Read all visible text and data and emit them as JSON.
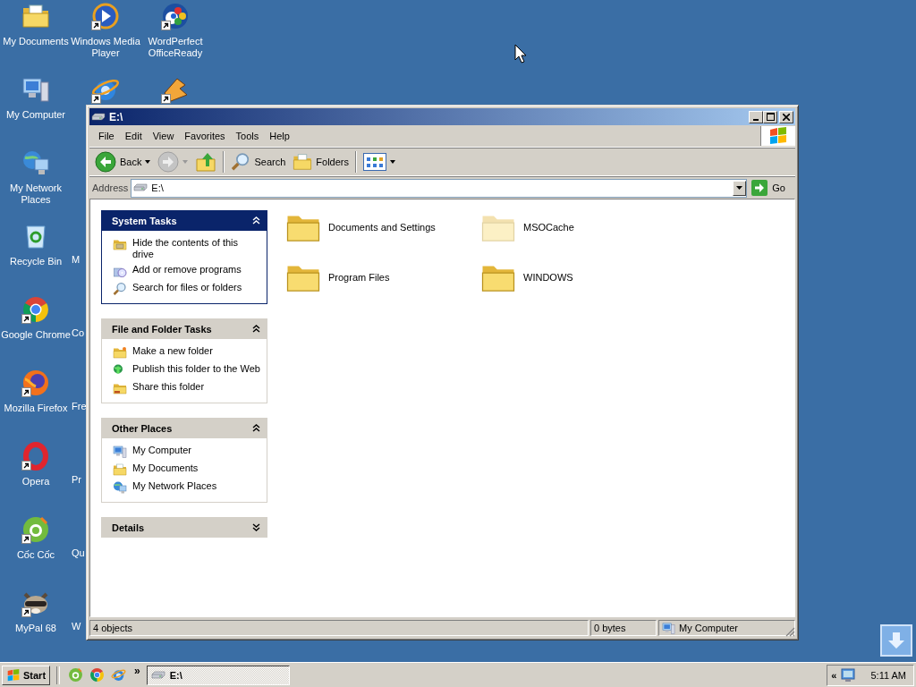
{
  "desktop": {
    "icons": [
      {
        "kind": "documents",
        "label": "My Documents",
        "shortcut": false
      },
      {
        "kind": "media-player",
        "label": "Windows Media Player",
        "shortcut": true
      },
      {
        "kind": "wordperfect",
        "label": "WordPerfect OfficeReady",
        "shortcut": true
      },
      {
        "kind": "computer",
        "label": "My Computer",
        "shortcut": false
      },
      {
        "kind": "ie",
        "shortcut": true
      },
      {
        "kind": "winamp",
        "shortcut": true
      },
      {
        "kind": "network",
        "label": "My Network Places",
        "shortcut": false
      },
      {
        "kind": "recycle",
        "label": "Recycle Bin",
        "shortcut": false
      },
      {
        "kind": "chrome",
        "label": "Google Chrome",
        "shortcut": true
      },
      {
        "kind": "firefox",
        "label": "Mozilla Firefox",
        "shortcut": true
      },
      {
        "kind": "opera",
        "label": "Opera",
        "shortcut": true
      },
      {
        "kind": "coccoc",
        "label": "Cốc Cốc",
        "shortcut": true
      },
      {
        "kind": "mypal",
        "label": "MyPal 68",
        "shortcut": true
      },
      {
        "kind": "covered",
        "label": "M"
      },
      {
        "kind": "covered",
        "label": "Co"
      },
      {
        "kind": "covered",
        "label": "Fre"
      },
      {
        "kind": "covered",
        "label": "Pr"
      },
      {
        "kind": "covered",
        "label": "Qu"
      },
      {
        "kind": "covered",
        "label": "W"
      }
    ]
  },
  "window": {
    "title": "E:\\",
    "menu": [
      "File",
      "Edit",
      "View",
      "Favorites",
      "Tools",
      "Help"
    ],
    "toolbar": [
      {
        "kind": "back",
        "label": "Back",
        "disabled": false
      },
      {
        "kind": "forward",
        "disabled": true
      },
      {
        "kind": "up"
      },
      {
        "kind": "search",
        "label": "Search"
      },
      {
        "kind": "folders",
        "label": "Folders"
      },
      {
        "kind": "views"
      }
    ],
    "address": {
      "label": "Address",
      "value": "E:\\",
      "go": "Go"
    },
    "task_panes": [
      {
        "title": "System Tasks",
        "kind": "special",
        "expanded": true,
        "items": [
          {
            "label": "Hide the contents of this drive"
          },
          {
            "label": "Add or remove programs"
          },
          {
            "label": "Search for files or folders"
          }
        ]
      },
      {
        "title": "File and Folder Tasks",
        "kind": "normal",
        "expanded": true,
        "items": [
          {
            "label": "Make a new folder"
          },
          {
            "label": "Publish this folder to the Web"
          },
          {
            "label": "Share this folder"
          }
        ]
      },
      {
        "title": "Other Places",
        "kind": "normal",
        "expanded": true,
        "items": [
          {
            "label": "My Computer"
          },
          {
            "label": "My Documents"
          },
          {
            "label": "My Network Places"
          }
        ]
      },
      {
        "title": "Details",
        "kind": "normal",
        "expanded": false
      }
    ],
    "files": [
      {
        "name": "Documents and Settings",
        "hidden": false
      },
      {
        "name": "MSOCache",
        "hidden": true
      },
      {
        "name": "Program Files",
        "hidden": false
      },
      {
        "name": "WINDOWS",
        "hidden": false
      }
    ],
    "status_bar": {
      "objects": "4 objects",
      "size": "0 bytes",
      "zone": "My Computer"
    }
  },
  "taskbar": {
    "start": "Start",
    "quick_launch": [
      {
        "kind": "coccoc"
      },
      {
        "kind": "chrome"
      },
      {
        "kind": "ie"
      }
    ],
    "chevron": "»",
    "tasks": [
      {
        "label": "E:\\",
        "selected": true
      }
    ],
    "tray": {
      "chevron": "«",
      "clock": "5:11 AM"
    }
  }
}
